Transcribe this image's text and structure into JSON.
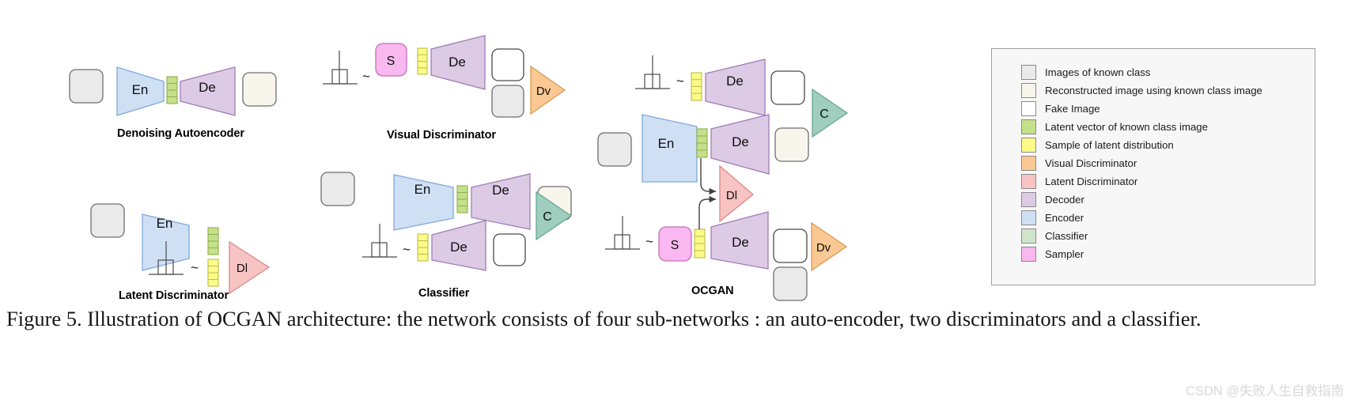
{
  "figure": {
    "caption": "Figure 5. Illustration of OCGAN architecture:  the network consists of four sub-networks :  an auto-encoder, two discriminators and a classifier.",
    "watermark": "CSDN @失败人生自救指南"
  },
  "panels": [
    {
      "id": "denoising-autoencoder",
      "title": "Denoising Autoencoder"
    },
    {
      "id": "visual-discriminator",
      "title": "Visual Discriminator"
    },
    {
      "id": "latent-discriminator",
      "title": "Latent Discriminator"
    },
    {
      "id": "classifier",
      "title": "Classifier"
    },
    {
      "id": "ocgan",
      "title": "OCGAN"
    }
  ],
  "block_labels": {
    "encoder": "En",
    "decoder": "De",
    "sampler": "S",
    "visual_discriminator": "Dv",
    "latent_discriminator": "Dl",
    "classifier": "C",
    "tilde": "~"
  },
  "colors": {
    "known_image": "#eaeaea",
    "reconstructed_image": "#f8f5ec",
    "fake_image": "#ffffff",
    "latent_known": "#c5e08a",
    "latent_sample": "#fbfb8a",
    "visual_discriminator": "#fac892",
    "latent_discriminator": "#f8c3c3",
    "decoder": "#ddcbe6",
    "encoder": "#cfe0f5",
    "classifier": "#9fcdbe",
    "classifier_legend": "#cfe5cb",
    "sampler": "#f9b8ef",
    "stroke": "#6e6e6e",
    "legend_bg": "#f7f7f7",
    "legend_border": "#9e9e9e",
    "watermark": "#d8d8d8"
  },
  "legend": {
    "items": [
      {
        "label": "Images of known class",
        "color": "#eaeaea"
      },
      {
        "label": "Reconstructed image using known class image",
        "color": "#f8f5ec"
      },
      {
        "label": "Fake Image",
        "color": "#ffffff"
      },
      {
        "label": "Latent vector of known class image",
        "color": "#c5e08a"
      },
      {
        "label": "Sample of latent distribution",
        "color": "#fbfb8a"
      },
      {
        "label": "Visual Discriminator",
        "color": "#fac892"
      },
      {
        "label": "Latent Discriminator",
        "color": "#f8c3c3"
      },
      {
        "label": "Decoder",
        "color": "#ddcbe6"
      },
      {
        "label": "Encoder",
        "color": "#cfe0f5"
      },
      {
        "label": "Classifier",
        "color": "#cfe5cb"
      },
      {
        "label": "Sampler",
        "color": "#f9b8ef"
      }
    ]
  }
}
